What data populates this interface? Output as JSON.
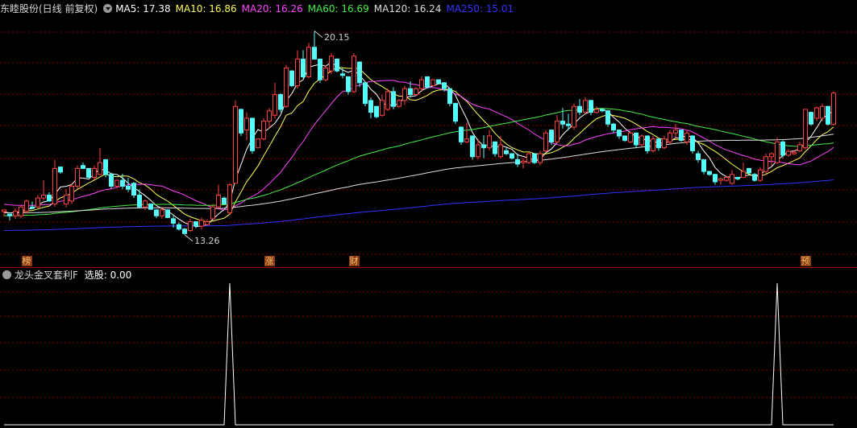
{
  "header": {
    "stock_title": "东睦股份(日线 前复权)",
    "ma_values": [
      {
        "name": "MA5",
        "value": "17.38",
        "color": "#ffffff"
      },
      {
        "name": "MA10",
        "value": "16.86",
        "color": "#ffff55"
      },
      {
        "name": "MA20",
        "value": "16.26",
        "color": "#ff44ff"
      },
      {
        "name": "MA60",
        "value": "16.69",
        "color": "#44ee44"
      },
      {
        "name": "MA120",
        "value": "16.24",
        "color": "#dddddd"
      },
      {
        "name": "MA250",
        "value": "15.01",
        "color": "#3333ff"
      }
    ]
  },
  "annotations": {
    "high_label": "20.15",
    "low_label": "13.26"
  },
  "events": [
    {
      "char": "榜",
      "index": 4
    },
    {
      "char": "涨",
      "index": 47
    },
    {
      "char": "财",
      "index": 62
    },
    {
      "char": "预",
      "index": 142
    }
  ],
  "indicator": {
    "name": "龙头金叉套利F",
    "field_label": "选股: 0.00",
    "signal_indices": [
      40,
      137
    ]
  },
  "colors": {
    "up": "#ff4040",
    "down": "#54fcfc",
    "grid": "#8b0000",
    "background": "#000000"
  },
  "chart_data": {
    "type": "candlestick",
    "title": "东睦股份(日线 前复权)",
    "price_range": [
      12.6,
      20.6
    ],
    "candles": [
      [
        14.04,
        14.1,
        13.88,
        14.1
      ],
      [
        13.96,
        13.96,
        13.74,
        13.9
      ],
      [
        13.9,
        14.15,
        13.8,
        14.05
      ],
      [
        13.9,
        14.25,
        13.83,
        14.2
      ],
      [
        14.05,
        14.45,
        13.98,
        14.4
      ],
      [
        14.2,
        14.38,
        14.12,
        14.15
      ],
      [
        14.2,
        14.6,
        14.15,
        14.5
      ],
      [
        14.5,
        15.1,
        14.42,
        14.6
      ],
      [
        14.6,
        14.7,
        14.38,
        14.4
      ],
      [
        14.3,
        15.8,
        14.2,
        15.5
      ],
      [
        15.55,
        15.55,
        15.32,
        15.38
      ],
      [
        14.3,
        14.8,
        14.18,
        14.6
      ],
      [
        14.4,
        15.0,
        14.3,
        14.9
      ],
      [
        14.9,
        15.6,
        14.8,
        15.5
      ],
      [
        15.6,
        15.7,
        15.48,
        15.5
      ],
      [
        15.5,
        15.52,
        15.18,
        15.2
      ],
      [
        15.2,
        15.6,
        15.12,
        15.5
      ],
      [
        15.3,
        16.2,
        15.28,
        15.7
      ],
      [
        15.8,
        15.8,
        15.2,
        15.3
      ],
      [
        15.3,
        15.35,
        14.8,
        14.9
      ],
      [
        14.9,
        15.12,
        14.82,
        15.1
      ],
      [
        15.1,
        15.32,
        14.8,
        14.9
      ],
      [
        14.9,
        15.18,
        14.7,
        14.8
      ],
      [
        15.0,
        15.05,
        14.5,
        14.6
      ],
      [
        14.6,
        14.8,
        14.15,
        14.2
      ],
      [
        14.2,
        14.45,
        14.1,
        14.4
      ],
      [
        14.3,
        14.32,
        14.1,
        14.12
      ],
      [
        14.1,
        14.12,
        13.82,
        13.9
      ],
      [
        13.9,
        14.2,
        13.8,
        14.1
      ],
      [
        14.1,
        14.12,
        13.82,
        13.84
      ],
      [
        13.8,
        13.9,
        13.5,
        13.65
      ],
      [
        13.6,
        13.68,
        13.4,
        13.45
      ],
      [
        13.45,
        13.48,
        13.26,
        13.3
      ],
      [
        13.4,
        13.8,
        13.35,
        13.7
      ],
      [
        13.7,
        13.72,
        13.48,
        13.55
      ],
      [
        13.55,
        13.85,
        13.44,
        13.75
      ],
      [
        13.6,
        13.78,
        13.58,
        13.7
      ],
      [
        13.8,
        14.3,
        13.78,
        14.2
      ],
      [
        14.2,
        14.95,
        14.15,
        14.6
      ],
      [
        14.5,
        14.55,
        14.28,
        14.3
      ],
      [
        14.0,
        15.0,
        13.95,
        14.95
      ],
      [
        15.0,
        17.8,
        14.98,
        17.6
      ],
      [
        17.5,
        17.52,
        16.6,
        16.7
      ],
      [
        16.8,
        17.4,
        16.45,
        17.2
      ],
      [
        17.2,
        17.22,
        16.0,
        16.1
      ],
      [
        16.2,
        16.52,
        16.18,
        16.5
      ],
      [
        16.5,
        17.2,
        16.45,
        17.1
      ],
      [
        17.1,
        17.55,
        16.85,
        17.45
      ],
      [
        17.3,
        18.4,
        17.2,
        18.0
      ],
      [
        18.0,
        18.05,
        17.4,
        17.5
      ],
      [
        17.6,
        19.0,
        17.55,
        18.9
      ],
      [
        18.8,
        18.82,
        18.25,
        18.3
      ],
      [
        18.3,
        19.5,
        18.2,
        19.2
      ],
      [
        19.2,
        19.5,
        18.55,
        18.6
      ],
      [
        18.6,
        19.75,
        18.55,
        19.6
      ],
      [
        19.6,
        20.15,
        19.18,
        19.2
      ],
      [
        19.2,
        19.22,
        18.4,
        18.5
      ],
      [
        18.5,
        19.0,
        18.45,
        18.9
      ],
      [
        18.8,
        19.4,
        18.7,
        19.3
      ],
      [
        19.2,
        19.22,
        18.75,
        18.8
      ],
      [
        18.7,
        18.9,
        18.55,
        18.65
      ],
      [
        18.6,
        18.62,
        18.0,
        18.1
      ],
      [
        18.1,
        19.4,
        18.05,
        19.3
      ],
      [
        19.1,
        19.12,
        18.25,
        18.4
      ],
      [
        18.4,
        18.42,
        17.6,
        17.7
      ],
      [
        17.8,
        17.9,
        17.2,
        17.4
      ],
      [
        17.6,
        17.62,
        17.2,
        17.25
      ],
      [
        17.3,
        18.0,
        17.25,
        17.8
      ],
      [
        17.5,
        18.2,
        17.45,
        18.1
      ],
      [
        18.1,
        18.25,
        17.5,
        17.6
      ],
      [
        17.6,
        17.85,
        17.56,
        17.8
      ],
      [
        17.8,
        18.3,
        17.65,
        18.2
      ],
      [
        18.2,
        18.45,
        17.9,
        18.0
      ],
      [
        18.0,
        18.25,
        17.95,
        18.2
      ],
      [
        18.2,
        18.62,
        18.1,
        18.5
      ],
      [
        18.6,
        18.62,
        18.2,
        18.25
      ],
      [
        18.3,
        18.52,
        18.28,
        18.5
      ],
      [
        18.5,
        18.52,
        18.35,
        18.38
      ],
      [
        18.4,
        18.42,
        18.1,
        18.2
      ],
      [
        18.2,
        18.22,
        17.6,
        17.7
      ],
      [
        17.7,
        17.72,
        17.0,
        17.1
      ],
      [
        16.9,
        16.92,
        16.3,
        16.4
      ],
      [
        16.4,
        17.05,
        16.35,
        16.5
      ],
      [
        16.6,
        16.62,
        15.8,
        15.9
      ],
      [
        15.9,
        16.5,
        15.8,
        16.3
      ],
      [
        16.3,
        16.62,
        15.85,
        16.2
      ],
      [
        16.2,
        16.8,
        16.1,
        16.6
      ],
      [
        16.4,
        16.42,
        15.9,
        16.0
      ],
      [
        15.9,
        16.6,
        15.85,
        16.3
      ],
      [
        16.1,
        16.2,
        15.95,
        16.0
      ],
      [
        16.0,
        16.02,
        15.8,
        15.85
      ],
      [
        15.8,
        16.0,
        15.55,
        15.65
      ],
      [
        15.7,
        15.85,
        15.5,
        15.75
      ],
      [
        15.7,
        16.05,
        15.65,
        16.0
      ],
      [
        16.0,
        16.02,
        15.65,
        15.7
      ],
      [
        15.7,
        16.1,
        15.6,
        16.0
      ],
      [
        16.1,
        16.8,
        16.05,
        16.7
      ],
      [
        16.8,
        16.82,
        16.3,
        16.4
      ],
      [
        16.4,
        17.3,
        16.35,
        17.1
      ],
      [
        17.1,
        17.55,
        16.85,
        17.0
      ],
      [
        17.0,
        17.35,
        16.8,
        16.95
      ],
      [
        16.9,
        17.7,
        16.8,
        17.6
      ],
      [
        17.6,
        17.85,
        17.3,
        17.4
      ],
      [
        17.4,
        17.9,
        17.35,
        17.8
      ],
      [
        17.8,
        17.82,
        17.3,
        17.4
      ],
      [
        17.4,
        17.6,
        17.35,
        17.5
      ],
      [
        17.5,
        17.52,
        17.4,
        17.45
      ],
      [
        17.45,
        17.48,
        16.9,
        17.0
      ],
      [
        17.0,
        17.05,
        16.7,
        16.8
      ],
      [
        16.8,
        16.82,
        16.5,
        16.6
      ],
      [
        16.6,
        16.62,
        16.4,
        16.45
      ],
      [
        16.4,
        16.75,
        16.35,
        16.7
      ],
      [
        16.7,
        16.72,
        16.2,
        16.3
      ],
      [
        16.3,
        16.65,
        16.25,
        16.6
      ],
      [
        16.6,
        16.62,
        16.0,
        16.1
      ],
      [
        16.1,
        16.6,
        16.05,
        16.5
      ],
      [
        16.5,
        16.52,
        16.1,
        16.2
      ],
      [
        16.2,
        16.6,
        16.15,
        16.5
      ],
      [
        16.4,
        16.8,
        16.35,
        16.7
      ],
      [
        16.7,
        17.0,
        16.5,
        16.8
      ],
      [
        16.8,
        16.82,
        16.4,
        16.45
      ],
      [
        16.4,
        16.8,
        16.3,
        16.7
      ],
      [
        16.6,
        16.62,
        16.0,
        16.1
      ],
      [
        16.0,
        16.1,
        15.7,
        15.8
      ],
      [
        15.8,
        15.82,
        15.3,
        15.4
      ],
      [
        15.4,
        15.42,
        15.25,
        15.3
      ],
      [
        15.3,
        15.32,
        14.95,
        15.05
      ],
      [
        15.1,
        15.2,
        14.95,
        15.15
      ],
      [
        15.1,
        15.25,
        15.05,
        15.2
      ],
      [
        15.0,
        15.45,
        14.95,
        15.3
      ],
      [
        15.2,
        15.22,
        15.1,
        15.15
      ],
      [
        15.2,
        15.7,
        15.18,
        15.4
      ],
      [
        15.5,
        15.52,
        15.3,
        15.35
      ],
      [
        15.3,
        15.35,
        15.05,
        15.1
      ],
      [
        15.1,
        15.55,
        15.05,
        15.45
      ],
      [
        15.4,
        16.0,
        15.3,
        15.9
      ],
      [
        15.9,
        16.05,
        15.6,
        16.0
      ],
      [
        15.7,
        16.55,
        15.65,
        16.4
      ],
      [
        16.4,
        16.45,
        15.85,
        15.95
      ],
      [
        15.95,
        16.15,
        15.9,
        16.08
      ],
      [
        16.0,
        16.1,
        15.95,
        16.05
      ],
      [
        16.1,
        16.4,
        16.05,
        16.3
      ],
      [
        16.2,
        17.5,
        16.15,
        17.5
      ],
      [
        17.4,
        17.42,
        16.95,
        17.0
      ],
      [
        17.2,
        17.6,
        17.1,
        17.55
      ],
      [
        17.2,
        17.7,
        17.1,
        17.6
      ],
      [
        17.6,
        17.62,
        16.95,
        17.0
      ],
      [
        17.0,
        18.1,
        16.95,
        18.05
      ]
    ]
  }
}
